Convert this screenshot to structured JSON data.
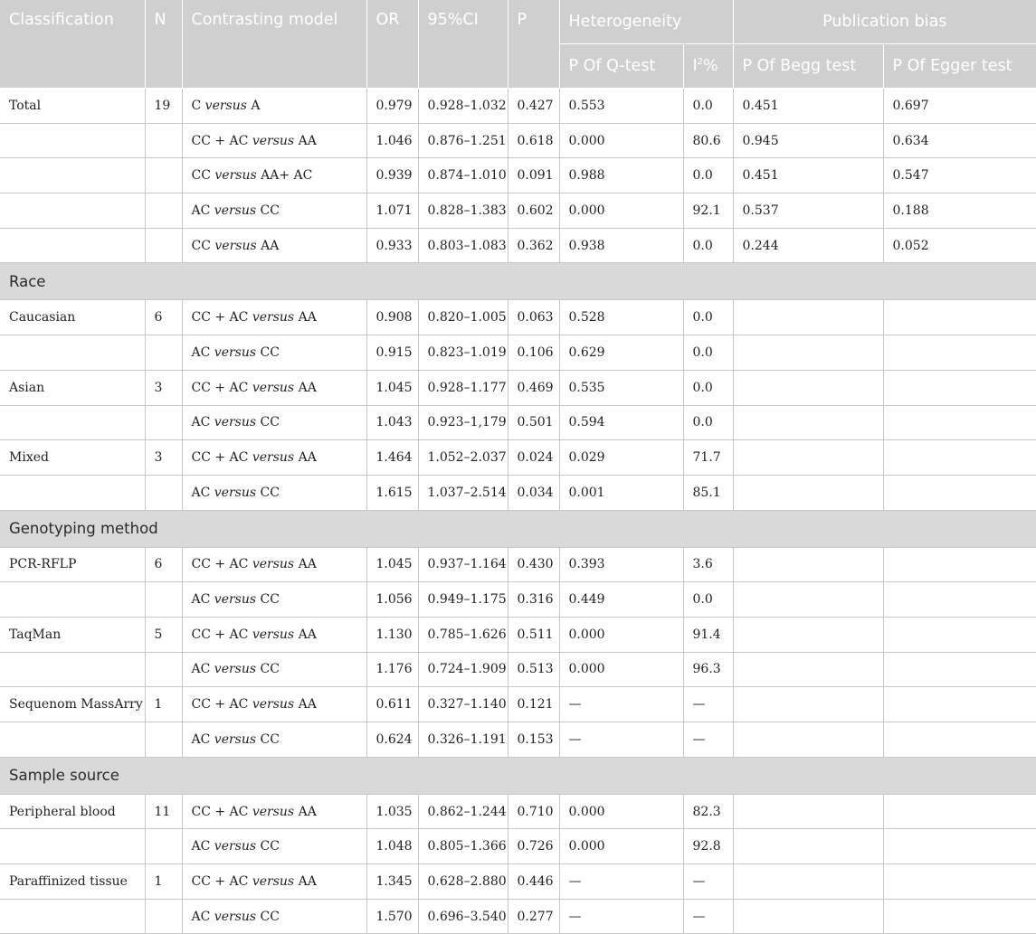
{
  "header": {
    "classification": "Classification",
    "n": "N",
    "contrasting_model": "Contrasting model",
    "or": "OR",
    "ci": "95%CI",
    "p": "P",
    "heterogeneity": "Heterogeneity",
    "publication_bias": "Publication bias",
    "p_q_test": "P Of Q-test",
    "i2_base": "I",
    "i2_sup": "2",
    "i2_suffix": "%",
    "p_begg": "P Of Begg test",
    "p_egger": "P Of Egger test"
  },
  "versus_word": "versus",
  "sections": [
    {
      "title": "",
      "rows": [
        {
          "classification": "Total",
          "n": "19",
          "m_left": "C",
          "m_right": "A",
          "or": "0.979",
          "ci": "0.928–1.032",
          "p": "0.427",
          "pq": "0.553",
          "i2": "0.0",
          "begg": "0.451",
          "egger": "0.697"
        },
        {
          "classification": "",
          "n": "",
          "m_left": "CC + AC",
          "m_right": "AA",
          "or": "1.046",
          "ci": "0.876–1.251",
          "p": "0.618",
          "pq": "0.000",
          "i2": "80.6",
          "begg": "0.945",
          "egger": "0.634"
        },
        {
          "classification": "",
          "n": "",
          "m_left": "CC",
          "m_right": "AA+ AC",
          "or": "0.939",
          "ci": "0.874–1.010",
          "p": "0.091",
          "pq": "0.988",
          "i2": "0.0",
          "begg": "0.451",
          "egger": "0.547"
        },
        {
          "classification": "",
          "n": "",
          "m_left": "AC",
          "m_right": "CC",
          "or": "1.071",
          "ci": "0.828–1.383",
          "p": "0.602",
          "pq": "0.000",
          "i2": "92.1",
          "begg": "0.537",
          "egger": "0.188"
        },
        {
          "classification": "",
          "n": "",
          "m_left": "CC",
          "m_right": "AA",
          "or": "0.933",
          "ci": "0.803–1.083",
          "p": "0.362",
          "pq": "0.938",
          "i2": "0.0",
          "begg": "0.244",
          "egger": "0.052"
        }
      ]
    },
    {
      "title": "Race",
      "rows": [
        {
          "classification": "Caucasian",
          "n": "6",
          "m_left": "CC + AC",
          "m_right": "AA",
          "or": "0.908",
          "ci": "0.820–1.005",
          "p": "0.063",
          "pq": "0.528",
          "i2": "0.0",
          "begg": "",
          "egger": ""
        },
        {
          "classification": "",
          "n": "",
          "m_left": "AC",
          "m_right": "CC",
          "or": "0.915",
          "ci": "0.823–1.019",
          "p": "0.106",
          "pq": "0.629",
          "i2": "0.0",
          "begg": "",
          "egger": ""
        },
        {
          "classification": "Asian",
          "n": "3",
          "m_left": "CC + AC",
          "m_right": "AA",
          "or": "1.045",
          "ci": "0.928–1.177",
          "p": "0.469",
          "pq": "0.535",
          "i2": "0.0",
          "begg": "",
          "egger": ""
        },
        {
          "classification": "",
          "n": "",
          "m_left": "AC",
          "m_right": "CC",
          "or": "1.043",
          "ci": "0.923–1,179",
          "p": "0.501",
          "pq": "0.594",
          "i2": "0.0",
          "begg": "",
          "egger": ""
        },
        {
          "classification": "Mixed",
          "n": "3",
          "m_left": "CC + AC",
          "m_right": "AA",
          "or": "1.464",
          "ci": "1.052–2.037",
          "p": "0.024",
          "pq": "0.029",
          "i2": "71.7",
          "begg": "",
          "egger": ""
        },
        {
          "classification": "",
          "n": "",
          "m_left": "AC",
          "m_right": "CC",
          "or": "1.615",
          "ci": "1.037–2.514",
          "p": "0.034",
          "pq": "0.001",
          "i2": "85.1",
          "begg": "",
          "egger": ""
        }
      ]
    },
    {
      "title": "Genotyping method",
      "rows": [
        {
          "classification": "PCR-RFLP",
          "n": "6",
          "m_left": "CC + AC",
          "m_right": "AA",
          "or": "1.045",
          "ci": "0.937–1.164",
          "p": "0.430",
          "pq": "0.393",
          "i2": "3.6",
          "begg": "",
          "egger": ""
        },
        {
          "classification": "",
          "n": "",
          "m_left": "AC",
          "m_right": "CC",
          "or": "1.056",
          "ci": "0.949–1.175",
          "p": "0.316",
          "pq": "0.449",
          "i2": "0.0",
          "begg": "",
          "egger": ""
        },
        {
          "classification": "TaqMan",
          "n": "5",
          "m_left": "CC + AC",
          "m_right": "AA",
          "or": "1.130",
          "ci": "0.785–1.626",
          "p": "0.511",
          "pq": "0.000",
          "i2": "91.4",
          "begg": "",
          "egger": ""
        },
        {
          "classification": "",
          "n": "",
          "m_left": "AC",
          "m_right": "CC",
          "or": "1.176",
          "ci": "0.724–1.909",
          "p": "0.513",
          "pq": "0.000",
          "i2": "96.3",
          "begg": "",
          "egger": ""
        },
        {
          "classification": "Sequenom MassArry",
          "n": "1",
          "m_left": "CC + AC",
          "m_right": "AA",
          "or": "0.611",
          "ci": "0.327–1.140",
          "p": "0.121",
          "pq": "—",
          "i2": "—",
          "begg": "",
          "egger": ""
        },
        {
          "classification": "",
          "n": "",
          "m_left": "AC",
          "m_right": "CC",
          "or": "0.624",
          "ci": "0.326–1.191",
          "p": "0.153",
          "pq": "—",
          "i2": "—",
          "begg": "",
          "egger": ""
        }
      ]
    },
    {
      "title": "Sample source",
      "rows": [
        {
          "classification": "Peripheral blood",
          "n": "11",
          "m_left": "CC + AC",
          "m_right": "AA",
          "or": "1.035",
          "ci": "0.862–1.244",
          "p": "0.710",
          "pq": "0.000",
          "i2": "82.3",
          "begg": "",
          "egger": ""
        },
        {
          "classification": "",
          "n": "",
          "m_left": "AC",
          "m_right": "CC",
          "or": "1.048",
          "ci": "0.805–1.366",
          "p": "0.726",
          "pq": "0.000",
          "i2": "92.8",
          "begg": "",
          "egger": ""
        },
        {
          "classification": "Paraffinized tissue",
          "n": "1",
          "m_left": "CC + AC",
          "m_right": "AA",
          "or": "1.345",
          "ci": "0.628–2.880",
          "p": "0.446",
          "pq": "—",
          "i2": "—",
          "begg": "",
          "egger": ""
        },
        {
          "classification": "",
          "n": "",
          "m_left": "AC",
          "m_right": "CC",
          "or": "1.570",
          "ci": "0.696–3.540",
          "p": "0.277",
          "pq": "—",
          "i2": "—",
          "begg": "",
          "egger": ""
        }
      ]
    }
  ]
}
